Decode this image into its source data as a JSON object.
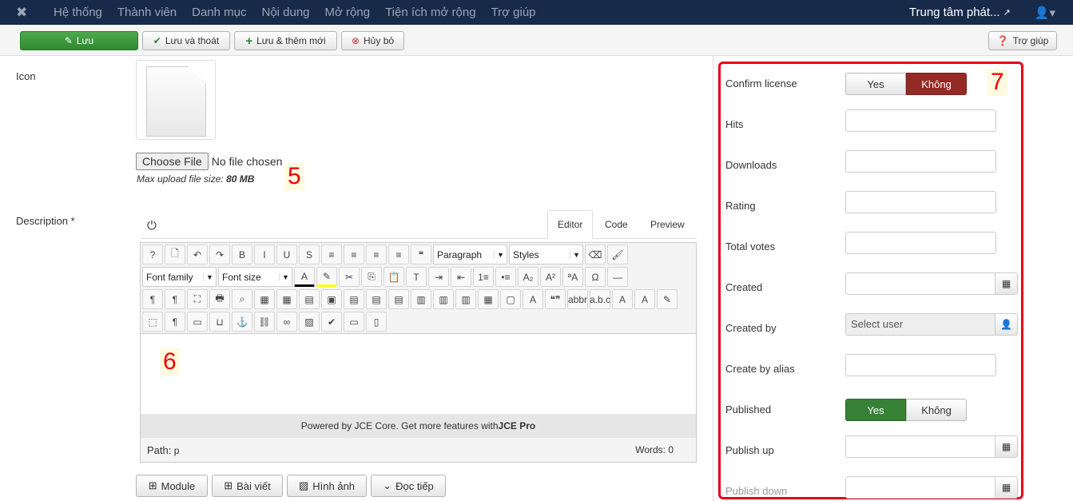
{
  "nav": {
    "items": [
      "Hệ thống",
      "Thành viên",
      "Danh mục",
      "Nội dung",
      "Mở rộng",
      "Tiện ích mở rộng",
      "Trợ giúp"
    ],
    "site": "Trung tâm phát..."
  },
  "toolbar": {
    "save": "Lưu",
    "save_close": "Lưu và thoát",
    "save_new": "Lưu & thêm mới",
    "cancel": "Hủy bỏ",
    "help": "Trợ giúp"
  },
  "form": {
    "icon_label": "Icon",
    "choose_file": "Choose File",
    "no_file": "No file chosen",
    "max_upload": "Max upload file size: ",
    "max_size": "80 MB",
    "description_label": "Description *"
  },
  "annotations": {
    "a5": "5",
    "a6": "6",
    "a7": "7"
  },
  "editor": {
    "tabs": [
      "Editor",
      "Code",
      "Preview"
    ],
    "paragraph": "Paragraph",
    "styles": "Styles",
    "font_family": "Font family",
    "font_size": "Font size",
    "powered": "Powered by JCE Core. Get more features with ",
    "powered_pro": "JCE Pro",
    "path_label": "Path:",
    "path_value": "p",
    "words": "Words: 0",
    "row1": [
      [
        "help",
        "?"
      ],
      [
        "new-document",
        "🗋"
      ],
      [
        "undo",
        "↶"
      ],
      [
        "redo",
        "↷"
      ],
      [
        "bold",
        "B"
      ],
      [
        "italic",
        "I"
      ],
      [
        "underline",
        "U"
      ],
      [
        "strikethrough",
        "S"
      ],
      [
        "justify",
        "≡"
      ],
      [
        "align-center",
        "≡"
      ],
      [
        "align-left",
        "≡"
      ],
      [
        "align-right",
        "≡"
      ],
      [
        "blockquote",
        "❝"
      ]
    ],
    "row1b": [
      [
        "eraser",
        "⌫"
      ],
      [
        "brush",
        "🖌"
      ]
    ],
    "row2": [
      [
        "cut",
        "✂"
      ],
      [
        "copy",
        "⎘"
      ],
      [
        "paste",
        "📋"
      ],
      [
        "paste-text",
        "T"
      ],
      [
        "indent",
        "⇥"
      ],
      [
        "outdent",
        "⇤"
      ],
      [
        "ordered-list",
        "1≡"
      ],
      [
        "unordered-list",
        "•≡"
      ],
      [
        "subscript",
        "A₂"
      ],
      [
        "superscript",
        "A²"
      ],
      [
        "font-style",
        "ªA"
      ],
      [
        "special-char",
        "Ω"
      ],
      [
        "horizontal-rule",
        "—"
      ]
    ],
    "row3": [
      [
        "ltr",
        "¶"
      ],
      [
        "rtl",
        "¶"
      ],
      [
        "fullscreen",
        "⛶"
      ],
      [
        "print",
        "🖶"
      ],
      [
        "search",
        "⌕"
      ],
      [
        "table",
        "▦"
      ],
      [
        "delete-table",
        "▦"
      ],
      [
        "row-props",
        "▤"
      ],
      [
        "cell-props",
        "▣"
      ],
      [
        "insert-row-before",
        "▤"
      ],
      [
        "insert-row-after",
        "▤"
      ],
      [
        "delete-row",
        "▤"
      ],
      [
        "insert-col-before",
        "▥"
      ],
      [
        "insert-col-after",
        "▥"
      ],
      [
        "delete-col",
        "▥"
      ],
      [
        "split-cell",
        "▦"
      ],
      [
        "merge-cell",
        "▢"
      ],
      [
        "style",
        "A"
      ],
      [
        "cite",
        "❝❞"
      ],
      [
        "abbr",
        "abbr"
      ],
      [
        "acronym",
        "a.b.c"
      ],
      [
        "del",
        "A"
      ],
      [
        "ins",
        "A"
      ],
      [
        "attributes",
        "✎"
      ]
    ],
    "row4": [
      [
        "visual-aid",
        "⬚"
      ],
      [
        "show-blocks",
        "¶"
      ],
      [
        "pdf",
        "▭"
      ],
      [
        "nonbreaking",
        "⊔"
      ],
      [
        "anchor",
        "⚓"
      ],
      [
        "unlink",
        "⛓"
      ],
      [
        "link",
        "∞"
      ],
      [
        "image",
        "▨"
      ],
      [
        "spellcheck",
        "✔"
      ],
      [
        "template",
        "▭"
      ],
      [
        "layout",
        "▯"
      ]
    ]
  },
  "buttons": {
    "module": "Module",
    "article": "Bài viết",
    "image": "Hình ảnh",
    "readmore": "Đọc tiếp"
  },
  "side": {
    "confirm_license": "Confirm license",
    "yes": "Yes",
    "no": "Không",
    "hits": "Hits",
    "downloads": "Downloads",
    "rating": "Rating",
    "total_votes": "Total votes",
    "created": "Created",
    "created_by": "Created by",
    "select_user": "Select user",
    "create_by_alias": "Create by alias",
    "published": "Published",
    "publish_up": "Publish up",
    "publish_down": "Publish down"
  },
  "colors": {
    "nav": "#172a4a",
    "save": "#3c9a3c",
    "danger": "#942a25",
    "success": "#378137",
    "highlight": "#e4001b"
  }
}
